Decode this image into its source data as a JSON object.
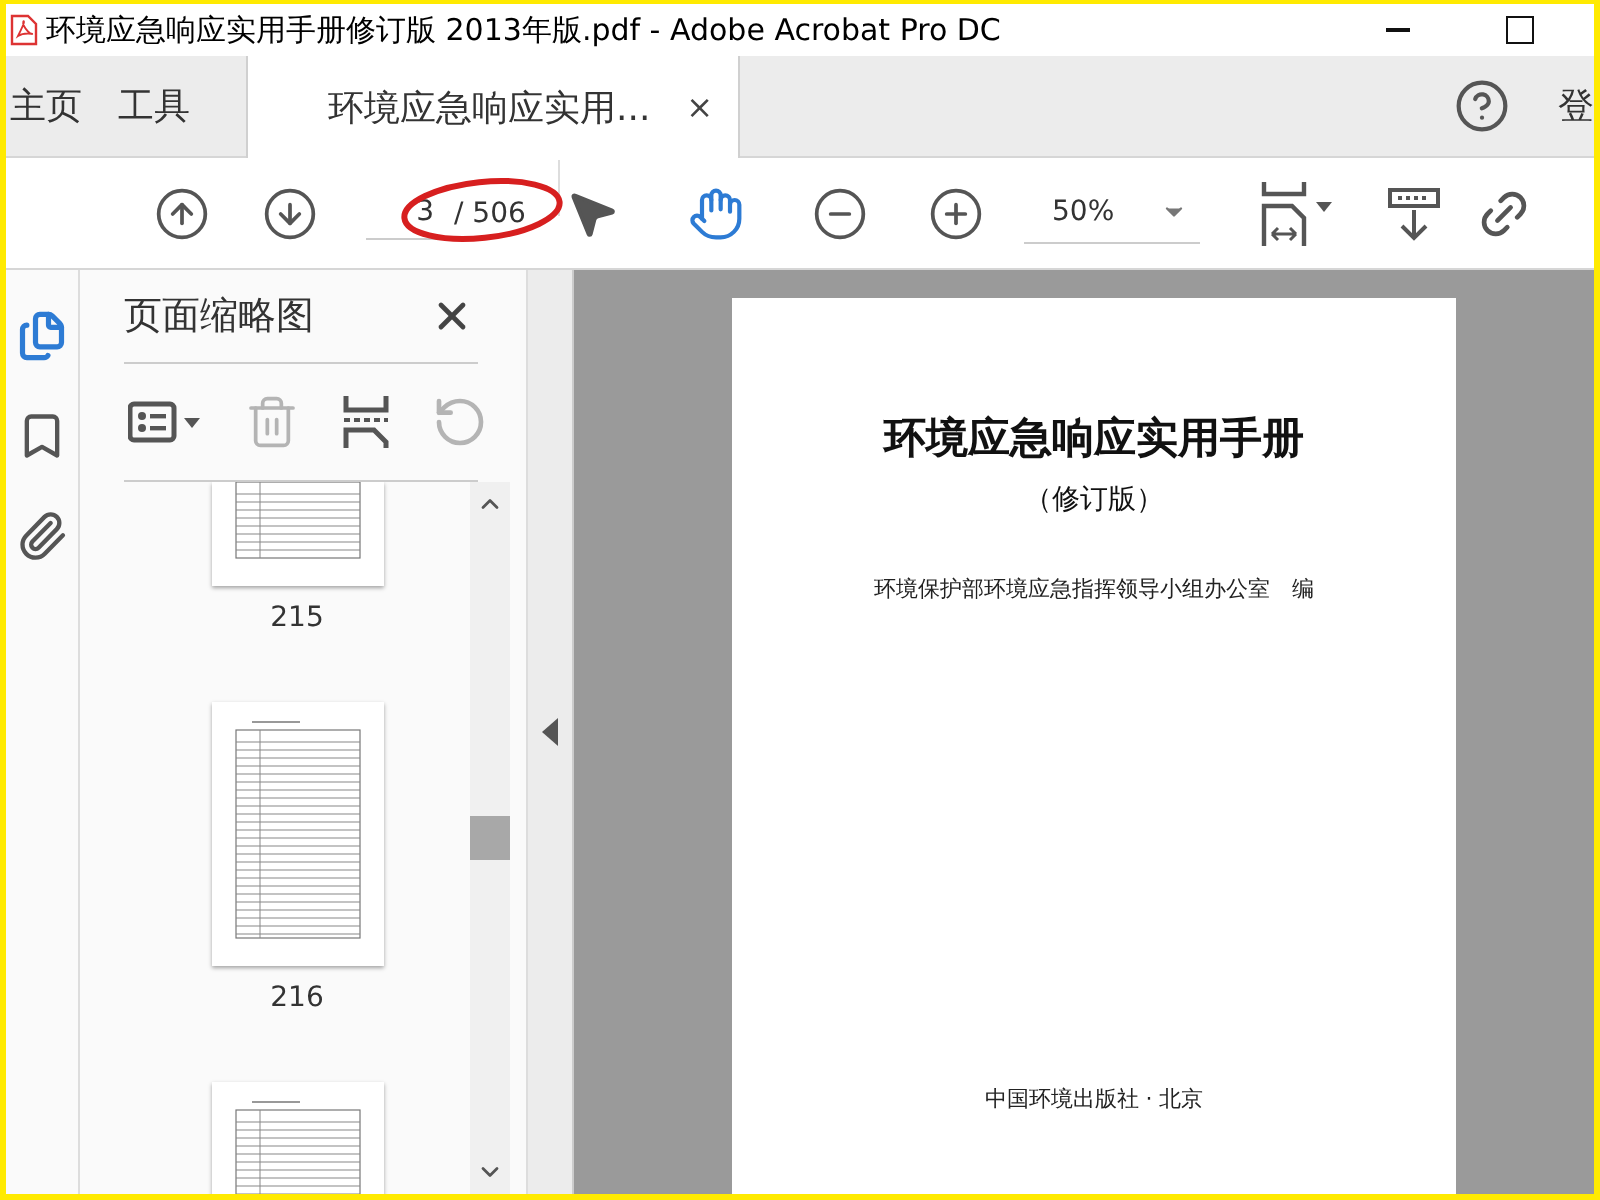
{
  "window": {
    "title": "环境应急响应实用手册修订版 2013年版.pdf - Adobe Acrobat Pro DC"
  },
  "nav_tabs": [
    {
      "label": "主页",
      "selected": false
    },
    {
      "label": "工具",
      "selected": false
    },
    {
      "label": "环境应急响应实用...",
      "selected": true,
      "close": "×"
    }
  ],
  "sign_in": "登",
  "toolbar": {
    "page_field": {
      "value": "3"
    },
    "page_total": "/ 506",
    "annotation_ellipse": true,
    "zoom": "50%",
    "tools": [
      {
        "kind": "pointer",
        "selected": false
      },
      {
        "kind": "hand",
        "selected": true
      }
    ]
  },
  "side_rail": [
    {
      "kind": "pages",
      "selected": true
    },
    {
      "kind": "bookmark",
      "selected": false
    },
    {
      "kind": "attachment",
      "selected": false
    }
  ],
  "thumbnail_panel": {
    "title": "页面缩略图",
    "tools": [
      {
        "kind": "options",
        "disabled": false
      },
      {
        "kind": "delete",
        "disabled": true
      },
      {
        "kind": "insert",
        "disabled": false
      },
      {
        "kind": "rotate",
        "disabled": true
      }
    ],
    "thumbnails": [
      {
        "kind": "partial",
        "label": "215"
      },
      {
        "kind": "full",
        "label": "216"
      },
      {
        "kind": "partial-top"
      }
    ]
  },
  "document": {
    "title": "环境应急响应实用手册",
    "subtitle": "（修订版）",
    "editor": "环境保护部环境应急指挥领导小组办公室　编",
    "publisher": "中国环境出版社 · 北京"
  }
}
